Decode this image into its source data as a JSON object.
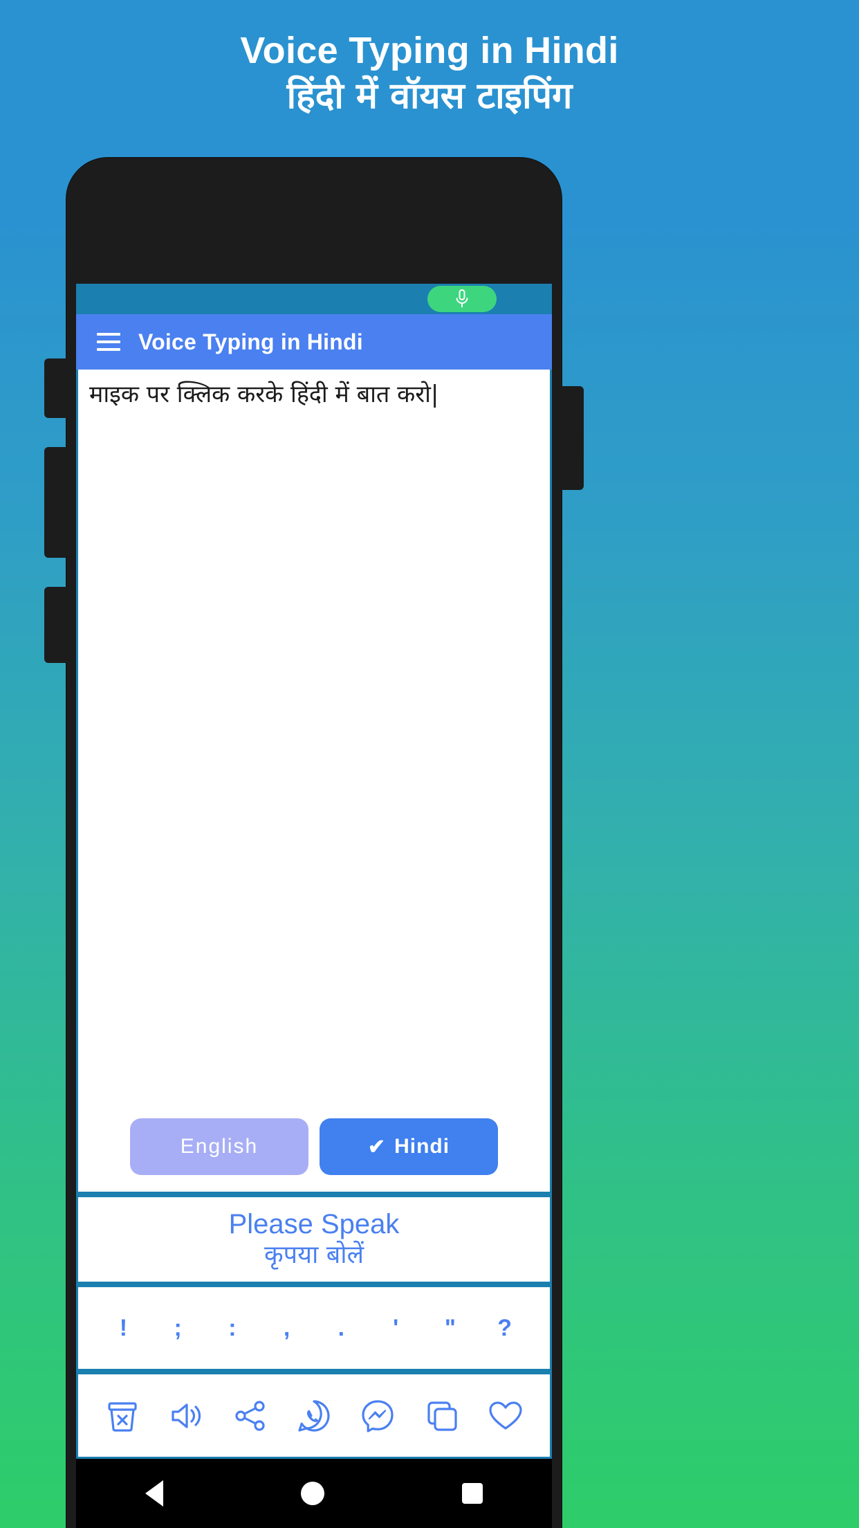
{
  "promo": {
    "title": "Voice Typing in Hindi",
    "subtitle": "हिंदी में वॉयस टाइपिंग"
  },
  "colors": {
    "bg_top": "#2a92d0",
    "bg_bottom": "#2ecd69",
    "statusbar": "#1b7fb0",
    "appbar": "#4a80f0",
    "accent": "#4a80f0",
    "mic_pill": "#3dd67f",
    "inactive_button": "#a8aef5",
    "active_button": "#4080ef",
    "divider": "#1b7fb0",
    "phone_frame": "#1c1c1c"
  },
  "statusbar": {
    "mic_icon": "microphone-icon"
  },
  "appbar": {
    "menu_icon": "hamburger-menu-icon",
    "title": "Voice Typing in Hindi"
  },
  "editor": {
    "text": "माइक पर क्लिक करके हिंदी में बात करो|",
    "placeholder": "माइक पर क्लिक करके हिंदी में बात करो"
  },
  "language_buttons": [
    {
      "label": "English",
      "selected": false,
      "check": ""
    },
    {
      "label": "Hindi",
      "selected": true,
      "check": "✔"
    }
  ],
  "speak_panel": {
    "english": "Please Speak",
    "hindi": "कृपया बोलें"
  },
  "punctuation": [
    {
      "label": "!",
      "name": "exclamation"
    },
    {
      "label": ";",
      "name": "semicolon"
    },
    {
      "label": ":",
      "name": "colon"
    },
    {
      "label": ",",
      "name": "comma"
    },
    {
      "label": ".",
      "name": "period"
    },
    {
      "label": "'",
      "name": "apostrophe"
    },
    {
      "label": "\"",
      "name": "quote"
    },
    {
      "label": "?",
      "name": "question"
    }
  ],
  "toolbar_icons": [
    {
      "name": "delete-icon"
    },
    {
      "name": "speaker-icon"
    },
    {
      "name": "share-icon"
    },
    {
      "name": "whatsapp-icon"
    },
    {
      "name": "messenger-icon"
    },
    {
      "name": "copy-icon"
    },
    {
      "name": "heart-icon"
    }
  ],
  "navbar": {
    "back": "back-icon",
    "home": "home-icon",
    "recents": "recents-icon"
  }
}
